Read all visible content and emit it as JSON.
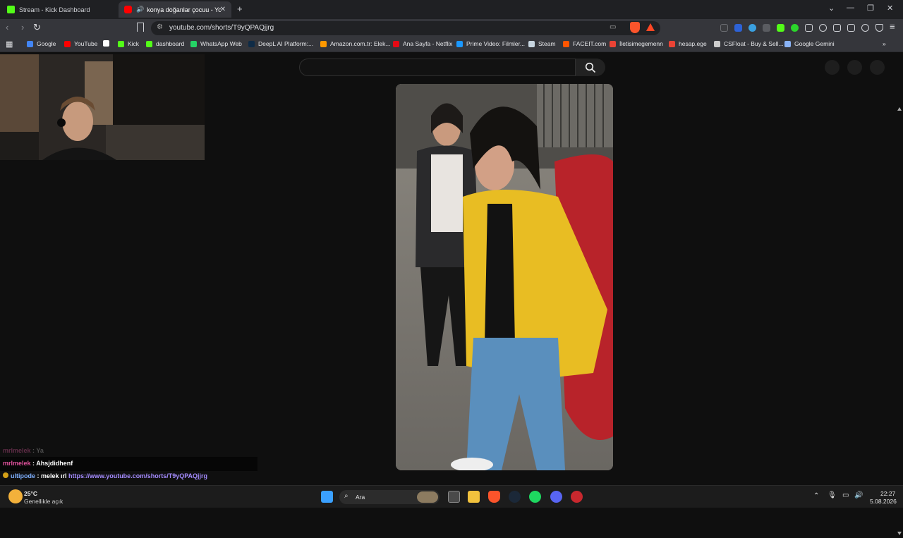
{
  "tabs": [
    {
      "label": "Stream - Kick Dashboard",
      "icon": "kick-icon"
    },
    {
      "label": "konya doğanlar çocuu - YouT",
      "icon": "youtube-icon"
    }
  ],
  "address": {
    "url": "youtube.com/shorts/T9yQPAQjjrg"
  },
  "bookmarks": [
    {
      "label": "Google",
      "color": "#4285f4"
    },
    {
      "label": "YouTube",
      "color": "#ff0000"
    },
    {
      "label": "",
      "color": "#ffffff"
    },
    {
      "label": "Kick",
      "color": "#53fc18"
    },
    {
      "label": "dashboard",
      "color": "#53fc18"
    },
    {
      "label": "WhatsApp Web",
      "color": "#25d366"
    },
    {
      "label": "DeepL AI Platform:...",
      "color": "#0f2b46"
    },
    {
      "label": "Amazon.com.tr: Elek...",
      "color": "#ff9900"
    },
    {
      "label": "Ana Sayfa - Netflix",
      "color": "#e50914"
    },
    {
      "label": "Prime Video: Filmler...",
      "color": "#1a98ff"
    },
    {
      "label": "Steam",
      "color": "#c7d5e0"
    },
    {
      "label": "FACEIT.com",
      "color": "#ff5500"
    },
    {
      "label": "İletisimegemenn",
      "color": "#ea4335"
    },
    {
      "label": "hesap.ege",
      "color": "#ea4335"
    },
    {
      "label": "CSFloat - Buy & Sell...",
      "color": "#cccccc"
    },
    {
      "label": "Google Gemini",
      "color": "#8ab4f8"
    }
  ],
  "chat": [
    {
      "user": "mrlmelek",
      "sep": " : ",
      "msg": "Ya",
      "user_color": "#c0508a",
      "msg_color": "#9a9a9a",
      "faded": true
    },
    {
      "user": "mrlmelek",
      "sep": " : ",
      "msg": "Ahsjdidhenf",
      "user_color": "#e0529c",
      "msg_color": "#ffffff",
      "faded": false
    },
    {
      "user": "ultipode",
      "sep": " : ",
      "msg": "melek ırl ",
      "link": "https://www.youtube.com/shorts/T9yQPAQjjrg",
      "user_color": "#7fb0ff",
      "msg_color": "#ffffff",
      "link_color": "#a58cff",
      "faded": false
    }
  ],
  "taskbar": {
    "weather_temp": "25°C",
    "weather_desc": "Genellikle açık",
    "search_label": "Ara",
    "time": "22:27",
    "date": "5.08.2026"
  },
  "colors": {
    "accent_kick": "#53fc18",
    "accent_youtube": "#ff0000"
  }
}
